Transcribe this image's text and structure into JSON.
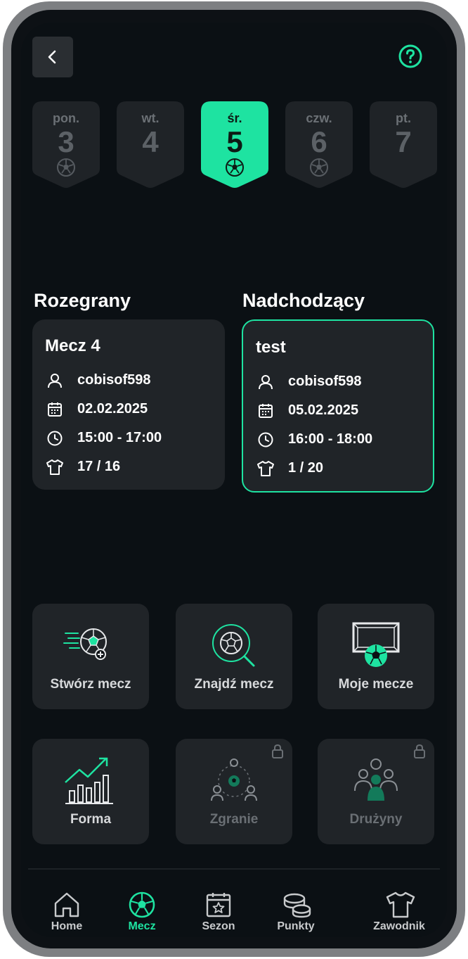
{
  "days": [
    {
      "name": "pon.",
      "number": "3",
      "has_match": true,
      "active": false
    },
    {
      "name": "wt.",
      "number": "4",
      "has_match": false,
      "active": false
    },
    {
      "name": "śr.",
      "number": "5",
      "has_match": true,
      "active": true
    },
    {
      "name": "czw.",
      "number": "6",
      "has_match": true,
      "active": false
    },
    {
      "name": "pt.",
      "number": "7",
      "has_match": false,
      "active": false
    }
  ],
  "played": {
    "heading": "Rozegrany",
    "title": "Mecz 4",
    "organizer": "cobisof598",
    "date": "02.02.2025",
    "time": "15:00 - 17:00",
    "players": "17 / 16"
  },
  "upcoming": {
    "heading": "Nadchodzący",
    "title": "test",
    "organizer": "cobisof598",
    "date": "05.02.2025",
    "time": "16:00 - 18:00",
    "players": "1 / 20"
  },
  "actions": {
    "create": "Stwórz mecz",
    "find": "Znajdź mecz",
    "my": "Moje mecze",
    "form": "Forma",
    "chemistry": "Zgranie",
    "teams": "Drużyny"
  },
  "nav": {
    "home": "Home",
    "match": "Mecz",
    "season": "Sezon",
    "points": "Punkty",
    "player": "Zawodnik"
  },
  "colors": {
    "accent": "#1ee3a1",
    "background": "#0b1014",
    "card": "#202428"
  }
}
